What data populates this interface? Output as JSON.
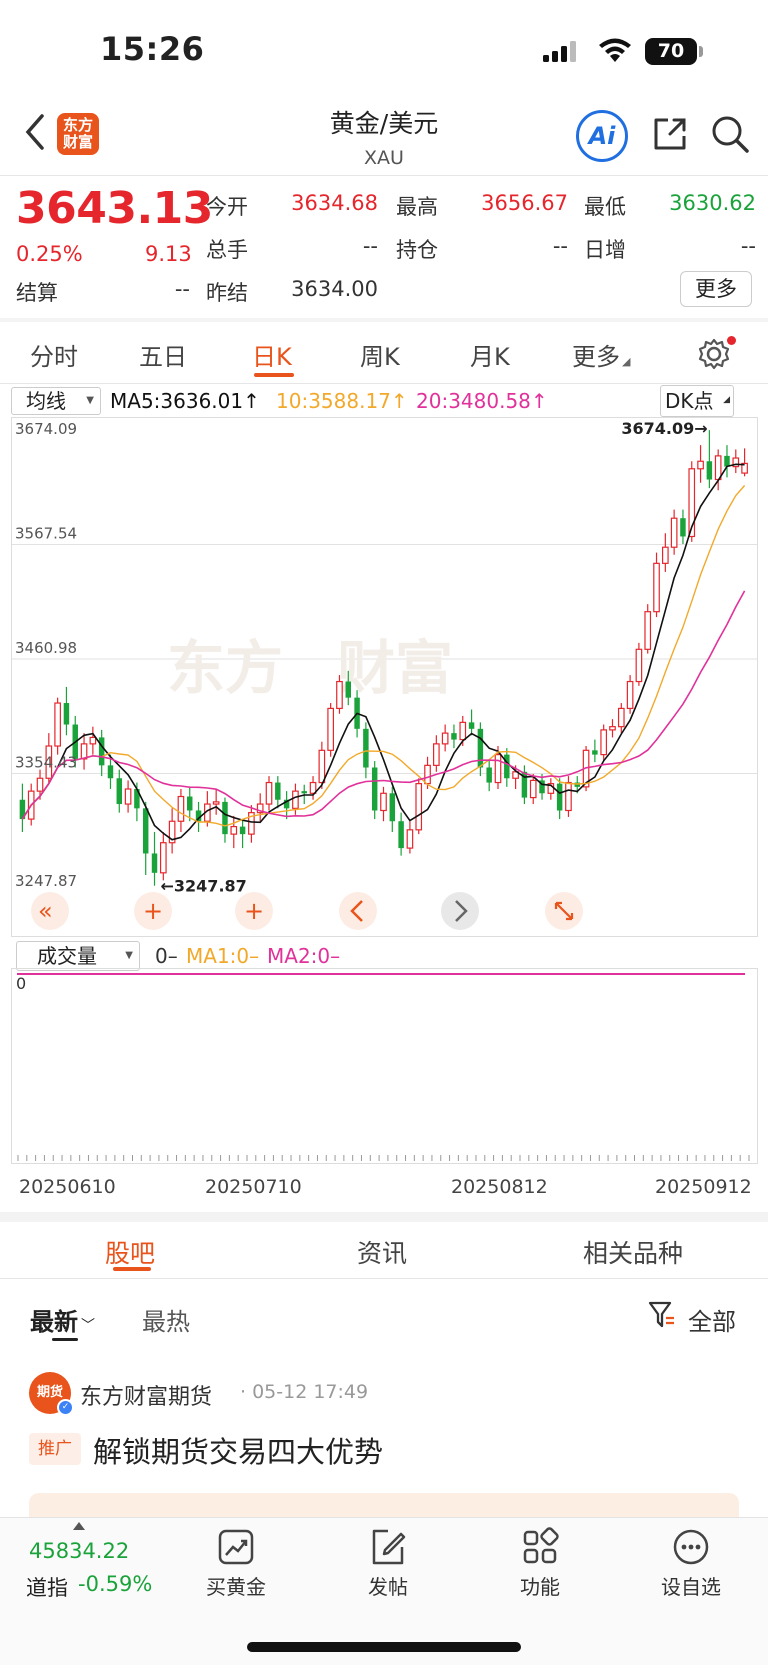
{
  "status_bar": {
    "time": "15:26",
    "battery": "70"
  },
  "header": {
    "title": "黄金/美元",
    "subtitle": "XAU",
    "logo_text_line1": "东方",
    "logo_text_line2": "财富",
    "ai_label": "Ai"
  },
  "quote": {
    "price": "3643.13",
    "change_pct": "0.25%",
    "change": "9.13",
    "settle_label": "结算",
    "settle_value": "--",
    "open_label": "今开",
    "open_value": "3634.68",
    "high_label": "最高",
    "high_value": "3656.67",
    "low_label": "最低",
    "low_value": "3630.62",
    "volume_label": "总手",
    "volume_value": "--",
    "position_label": "持仓",
    "position_value": "--",
    "daily_inc_label": "日增",
    "daily_inc_value": "--",
    "prev_settle_label": "昨结",
    "prev_settle_value": "3634.00",
    "more_label": "更多"
  },
  "kline_tabs": [
    "分时",
    "五日",
    "日K",
    "周K",
    "月K",
    "更多"
  ],
  "ma_bar": {
    "selector": "均线",
    "ma5": "MA5:3636.01↑",
    "ma10": "10:3588.17↑",
    "ma20": "20:3480.58↑",
    "dk_label": "DK点"
  },
  "chart_data": {
    "type": "candlestick",
    "y_ticks": [
      "3674.09",
      "3567.54",
      "3460.98",
      "3354.43",
      "3247.87"
    ],
    "ylim": [
      3247.87,
      3674.09
    ],
    "max_label": "3674.09→",
    "min_label": "←3247.87",
    "x_ticks": [
      "20250610",
      "20250710",
      "20250812",
      "20250912"
    ],
    "series": [
      {
        "name": "MA5",
        "color": "#111111"
      },
      {
        "name": "MA10",
        "color": "#f2a92b"
      },
      {
        "name": "MA20",
        "color": "#e0329a"
      }
    ],
    "candles": [
      [
        3330,
        3312,
        3345,
        3300
      ],
      [
        3312,
        3338,
        3345,
        3306
      ],
      [
        3338,
        3350,
        3358,
        3330
      ],
      [
        3350,
        3380,
        3392,
        3345
      ],
      [
        3380,
        3420,
        3425,
        3372
      ],
      [
        3420,
        3400,
        3435,
        3390
      ],
      [
        3400,
        3368,
        3408,
        3360
      ],
      [
        3368,
        3382,
        3392,
        3358
      ],
      [
        3382,
        3388,
        3398,
        3372
      ],
      [
        3388,
        3362,
        3395,
        3352
      ],
      [
        3362,
        3350,
        3372,
        3340
      ],
      [
        3350,
        3326,
        3358,
        3318
      ],
      [
        3326,
        3340,
        3348,
        3318
      ],
      [
        3340,
        3322,
        3346,
        3310
      ],
      [
        3322,
        3280,
        3328,
        3260
      ],
      [
        3280,
        3262,
        3300,
        3250
      ],
      [
        3262,
        3290,
        3300,
        3255
      ],
      [
        3290,
        3310,
        3322,
        3280
      ],
      [
        3310,
        3333,
        3340,
        3300
      ],
      [
        3333,
        3320,
        3342,
        3310
      ],
      [
        3320,
        3310,
        3328,
        3300
      ],
      [
        3310,
        3326,
        3338,
        3305
      ],
      [
        3326,
        3328,
        3340,
        3316
      ],
      [
        3328,
        3298,
        3332,
        3290
      ],
      [
        3298,
        3305,
        3315,
        3285
      ],
      [
        3305,
        3298,
        3312,
        3285
      ],
      [
        3298,
        3318,
        3325,
        3290
      ],
      [
        3318,
        3326,
        3336,
        3310
      ],
      [
        3326,
        3346,
        3352,
        3320
      ],
      [
        3346,
        3330,
        3352,
        3322
      ],
      [
        3330,
        3322,
        3338,
        3312
      ],
      [
        3322,
        3338,
        3345,
        3316
      ],
      [
        3338,
        3336,
        3344,
        3326
      ],
      [
        3336,
        3346,
        3352,
        3330
      ],
      [
        3346,
        3376,
        3384,
        3340
      ],
      [
        3376,
        3415,
        3420,
        3370
      ],
      [
        3415,
        3440,
        3446,
        3410
      ],
      [
        3440,
        3425,
        3450,
        3418
      ],
      [
        3425,
        3396,
        3432,
        3388
      ],
      [
        3396,
        3360,
        3402,
        3350
      ],
      [
        3360,
        3320,
        3366,
        3312
      ],
      [
        3320,
        3336,
        3342,
        3310
      ],
      [
        3336,
        3310,
        3342,
        3300
      ],
      [
        3310,
        3285,
        3318,
        3278
      ],
      [
        3285,
        3302,
        3310,
        3280
      ],
      [
        3302,
        3345,
        3350,
        3298
      ],
      [
        3345,
        3362,
        3370,
        3340
      ],
      [
        3362,
        3382,
        3390,
        3356
      ],
      [
        3382,
        3392,
        3400,
        3375
      ],
      [
        3392,
        3386,
        3400,
        3378
      ],
      [
        3386,
        3402,
        3408,
        3380
      ],
      [
        3402,
        3396,
        3414,
        3390
      ],
      [
        3396,
        3360,
        3402,
        3352
      ],
      [
        3360,
        3346,
        3366,
        3338
      ],
      [
        3346,
        3372,
        3380,
        3340
      ],
      [
        3372,
        3350,
        3378,
        3342
      ],
      [
        3350,
        3356,
        3362,
        3340
      ],
      [
        3356,
        3332,
        3362,
        3326
      ],
      [
        3332,
        3348,
        3354,
        3326
      ],
      [
        3348,
        3336,
        3354,
        3330
      ],
      [
        3336,
        3345,
        3350,
        3330
      ],
      [
        3345,
        3320,
        3350,
        3312
      ],
      [
        3320,
        3346,
        3352,
        3314
      ],
      [
        3346,
        3342,
        3352,
        3336
      ],
      [
        3342,
        3376,
        3380,
        3338
      ],
      [
        3376,
        3372,
        3386,
        3365
      ],
      [
        3372,
        3395,
        3400,
        3366
      ],
      [
        3395,
        3398,
        3405,
        3388
      ],
      [
        3398,
        3415,
        3420,
        3392
      ],
      [
        3415,
        3440,
        3446,
        3410
      ],
      [
        3440,
        3470,
        3476,
        3436
      ],
      [
        3470,
        3505,
        3512,
        3466
      ],
      [
        3505,
        3550,
        3560,
        3500
      ],
      [
        3550,
        3565,
        3578,
        3542
      ],
      [
        3565,
        3592,
        3600,
        3558
      ],
      [
        3592,
        3575,
        3600,
        3568
      ],
      [
        3575,
        3638,
        3645,
        3570
      ],
      [
        3638,
        3645,
        3660,
        3625
      ],
      [
        3645,
        3628,
        3674,
        3620
      ],
      [
        3628,
        3650,
        3656,
        3618
      ],
      [
        3650,
        3640,
        3660,
        3630
      ],
      [
        3640,
        3648,
        3656,
        3634
      ],
      [
        3634,
        3643,
        3657,
        3631
      ]
    ],
    "ma5_end": 3636.01,
    "ma10_end": 3588.17,
    "ma20_end": 3480.58
  },
  "volume": {
    "selector": "成交量",
    "value": "0–",
    "ma1": "MA1:0–",
    "ma2": "MA2:0–",
    "axis_zero": "0"
  },
  "content_tabs": [
    "股吧",
    "资讯",
    "相关品种"
  ],
  "filters": {
    "latest": "最新",
    "hot": "最热",
    "all": "全部"
  },
  "post": {
    "author": "东方财富期货",
    "time": "· 05-12 17:49",
    "badge": "推广",
    "title": "解锁期货交易四大优势",
    "avatar_text": "期货"
  },
  "bottom": {
    "index_value": "45834.22",
    "index_name": "道指",
    "index_pct": "-0.59%",
    "buttons": [
      "买黄金",
      "发帖",
      "功能",
      "设自选"
    ]
  },
  "colors": {
    "up": "#e5262c",
    "down": "#1aa33a",
    "accent": "#e8541c",
    "ai": "#1f6fe0"
  }
}
